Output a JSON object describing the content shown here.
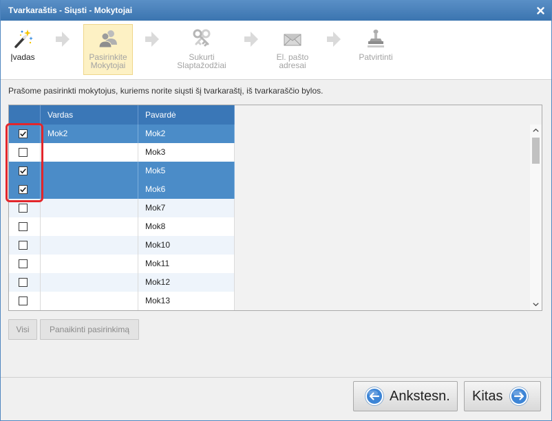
{
  "window": {
    "title": "Tvarkaraštis - Siųsti - Mokytojai"
  },
  "icons": {
    "close": "close-icon",
    "step_arrow": "arrow-right-icon",
    "checkmark": "checkmark-icon",
    "scroll_up": "chevron-up-icon",
    "scroll_down": "chevron-down-icon",
    "back": "arrow-left-circle-icon",
    "next": "arrow-right-circle-icon"
  },
  "wizard": {
    "steps": [
      {
        "lines": [
          "Įvadas"
        ],
        "icon": "magic-wand-icon",
        "current": false,
        "enabled": true
      },
      {
        "lines": [
          "Pasirinkite",
          "Mokytojai"
        ],
        "icon": "users-icon",
        "current": true,
        "enabled": false
      },
      {
        "lines": [
          "Sukurti",
          "Slaptažodžiai"
        ],
        "icon": "keys-icon",
        "current": false,
        "enabled": false
      },
      {
        "lines": [
          "El. pašto",
          "adresai"
        ],
        "icon": "envelope-icon",
        "current": false,
        "enabled": false
      },
      {
        "lines": [
          "Patvirtinti"
        ],
        "icon": "stamp-icon",
        "current": false,
        "enabled": false
      }
    ]
  },
  "instruction": "Prašome pasirinkti mokytojus, kuriems norite siųsti šį tvarkaraštį, iš tvarkaraščio bylos.",
  "grid": {
    "headers": {
      "vardas": "Vardas",
      "pavarde": "Pavardė"
    },
    "rows": [
      {
        "checked": true,
        "selected": true,
        "vardas": "Mok2",
        "pavarde": "Mok2"
      },
      {
        "checked": false,
        "selected": false,
        "vardas": "",
        "pavarde": "Mok3"
      },
      {
        "checked": true,
        "selected": true,
        "vardas": "",
        "pavarde": "Mok5"
      },
      {
        "checked": true,
        "selected": true,
        "vardas": "",
        "pavarde": "Mok6"
      },
      {
        "checked": false,
        "selected": false,
        "vardas": "",
        "pavarde": "Mok7"
      },
      {
        "checked": false,
        "selected": false,
        "vardas": "",
        "pavarde": "Mok8"
      },
      {
        "checked": false,
        "selected": false,
        "vardas": "",
        "pavarde": "Mok10"
      },
      {
        "checked": false,
        "selected": false,
        "vardas": "",
        "pavarde": "Mok11"
      },
      {
        "checked": false,
        "selected": false,
        "vardas": "",
        "pavarde": "Mok12"
      },
      {
        "checked": false,
        "selected": false,
        "vardas": "",
        "pavarde": "Mok13"
      }
    ],
    "scroll": {
      "position": 0,
      "visible_fraction": 0.16
    }
  },
  "selection_buttons": {
    "select_all": "Visi",
    "clear": "Panaikinti pasirinkimą"
  },
  "footer": {
    "back": "Ankstesn.",
    "next": "Kitas"
  },
  "colors": {
    "title_bar": "#3f7dbd",
    "grid_header": "#3a77b7",
    "row_selected": "#4b8cc8",
    "row_alt": "#eef4fb",
    "current_step_bg": "#fdf1c4",
    "annotation": "#e3262b"
  }
}
